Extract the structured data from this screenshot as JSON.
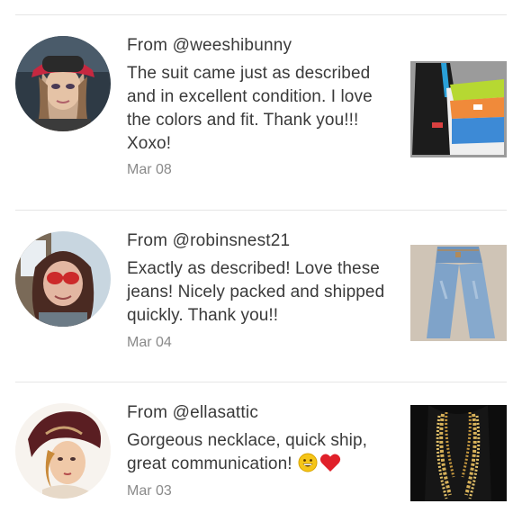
{
  "reviews": [
    {
      "from": "From @weeshibunny",
      "body": "The suit came just as described and in excellent condition. I love the colors and fit. Thank you!!! Xoxo!",
      "date": "Mar 08",
      "avatar": "user-avatar-woman-red-cap",
      "thumbnail": "adidas-track-suit-photo"
    },
    {
      "from": "From @robinsnest21",
      "body": "Exactly as described! Love these jeans! Nicely packed and shipped quickly. Thank you!!",
      "date": "Mar 04",
      "avatar": "user-avatar-woman-red-sunglasses",
      "thumbnail": "blue-jeans-photo"
    },
    {
      "from": "From @ellasattic",
      "body": "Gorgeous necklace, quick ship, great communication!",
      "body_emojis": [
        "grinning-face-emoji",
        "red-heart-emoji"
      ],
      "date": "Mar 03",
      "avatar": "user-avatar-vintage-portrait",
      "thumbnail": "gold-chain-necklace-photo"
    }
  ],
  "colors": {
    "text": "#3a3a3a",
    "date": "#8a8a8a",
    "divider": "#e6e6e6"
  }
}
